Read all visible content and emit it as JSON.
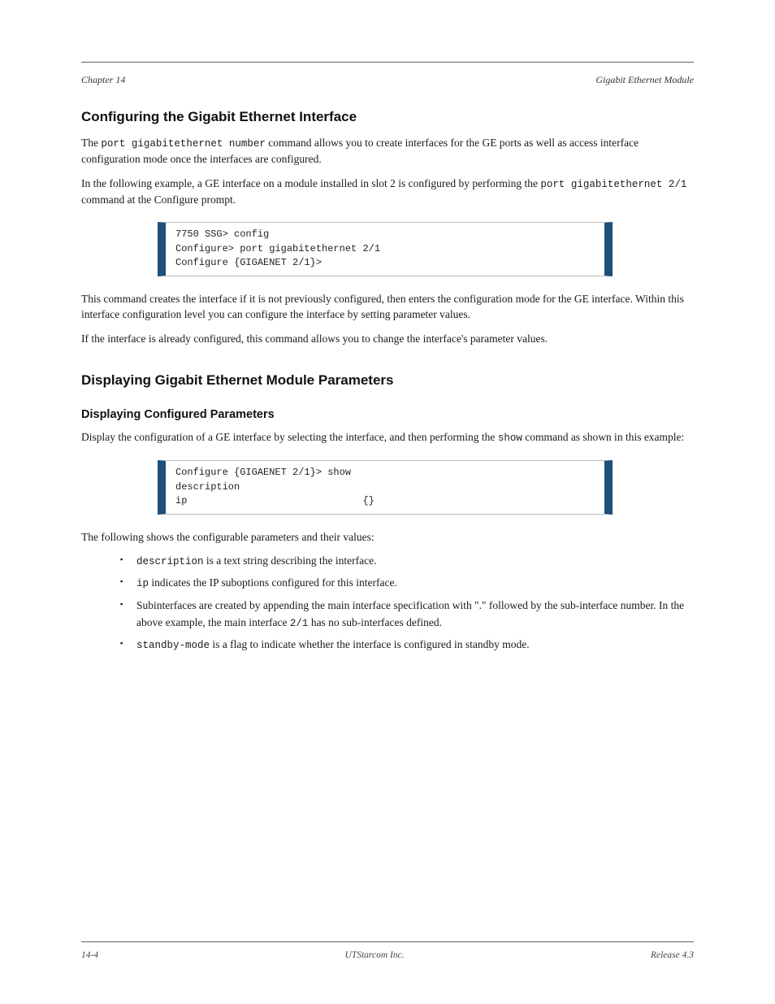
{
  "header": {
    "left": "Chapter 14",
    "right": "Gigabit Ethernet Module"
  },
  "section1": {
    "title": "Configuring the Gigabit Ethernet Interface",
    "para1_pre": "The ",
    "para1_cmd": "port gigabitethernet number",
    "para1_post": " command allows you to create interfaces for the GE ports as well as access interface configuration mode once the interfaces are configured.",
    "para2_pre": "In the following example, a GE interface on a module installed in slot 2 is configured by performing the ",
    "para2_cmd": "port gigabitethernet 2/1",
    "para2_post": " command at the Configure prompt.",
    "code": "7750 SSG> config\nConfigure> port gigabitethernet 2/1\nConfigure {GIGAENET 2/1}>",
    "para3": "This command creates the interface if it is not previously configured, then enters the configuration mode for the GE interface. Within this interface configuration level you can configure the interface by setting parameter values.",
    "para4": "If the interface is already configured, this command allows you to change the interface's parameter values."
  },
  "section2": {
    "title": "Displaying Gigabit Ethernet Module Parameters",
    "subtitle": "Displaying Configured Parameters",
    "para1_pre": "Display the configuration of a GE interface by selecting the interface, and then performing the ",
    "para1_cmd": "show",
    "para1_post": " command as shown in this example:",
    "code": "Configure {GIGAENET 2/1}> show\ndescription                     \nip                              {}",
    "para2": "The following shows the configurable parameters and their values:",
    "bullets": [
      {
        "pre": "",
        "cmd": "description",
        "post": " is a text string describing the interface."
      },
      {
        "pre": "",
        "cmd": "ip",
        "post": " indicates the IP suboptions configured for this interface."
      },
      {
        "pre": "Subinterfaces are created by appending the main interface specification with \".\" followed by the sub-interface number. In the above example, the main interface ",
        "cmd": "2/1",
        "post": " has no sub-interfaces defined."
      },
      {
        "pre": "",
        "cmd": "standby-mode",
        "post": " is a flag to indicate whether the interface is configured in standby mode."
      }
    ]
  },
  "footer": {
    "left": "14-4",
    "center": "UTStarcom Inc.",
    "right": "Release 4.3"
  }
}
